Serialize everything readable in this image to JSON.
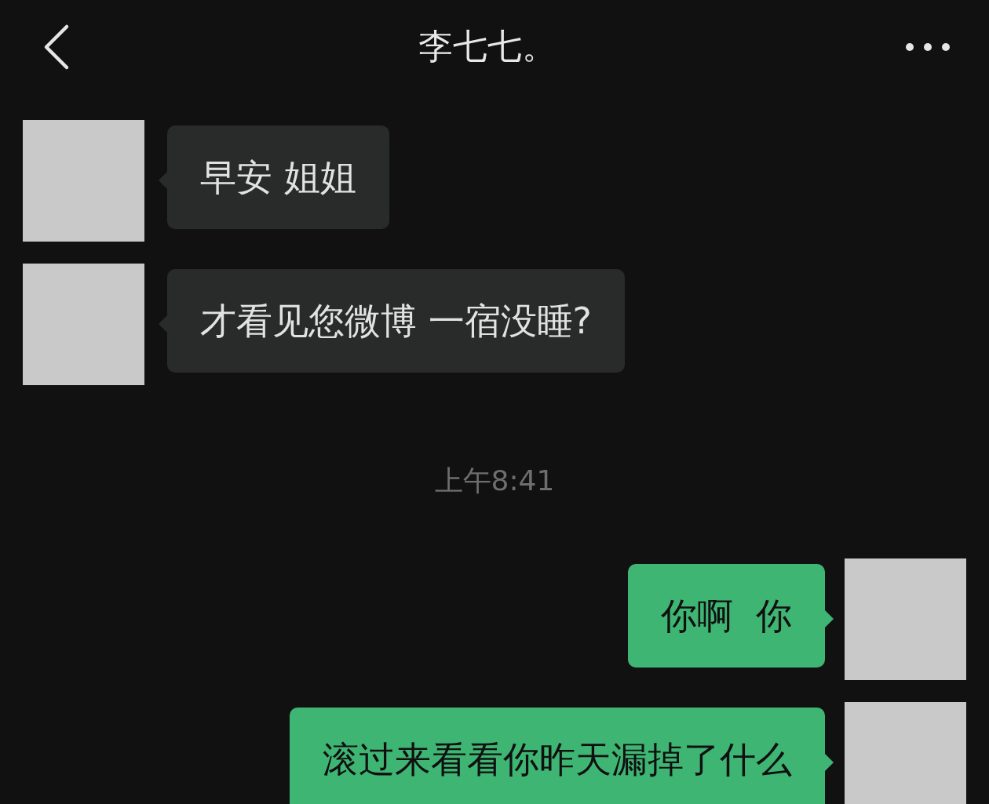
{
  "header": {
    "title": "李七七。"
  },
  "messages": [
    {
      "kind": "incoming",
      "text": "早安 姐姐"
    },
    {
      "kind": "incoming",
      "text": "才看见您微博 一宿没睡?"
    },
    {
      "kind": "time",
      "text": "上午8:41"
    },
    {
      "kind": "outgoing",
      "text": "你啊  你"
    },
    {
      "kind": "outgoing",
      "text": "滚过来看看你昨天漏掉了什么"
    }
  ]
}
